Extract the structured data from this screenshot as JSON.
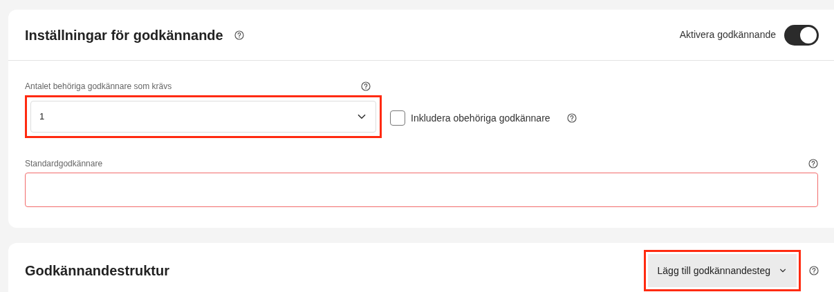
{
  "settings": {
    "title": "Inställningar för godkännande",
    "toggle": {
      "label": "Aktivera godkännande",
      "on": true
    },
    "count_field": {
      "label": "Antalet behöriga godkännare som krävs",
      "value": "1",
      "highlighted": true
    },
    "checkbox": {
      "label": "Inkludera obehöriga godkännare",
      "checked": false
    },
    "default_field": {
      "label": "Standardgodkännare",
      "invalid": true
    }
  },
  "structure": {
    "title": "Godkännandestruktur",
    "button": {
      "label": "Lägg till godkännandesteg",
      "highlighted": true
    }
  }
}
